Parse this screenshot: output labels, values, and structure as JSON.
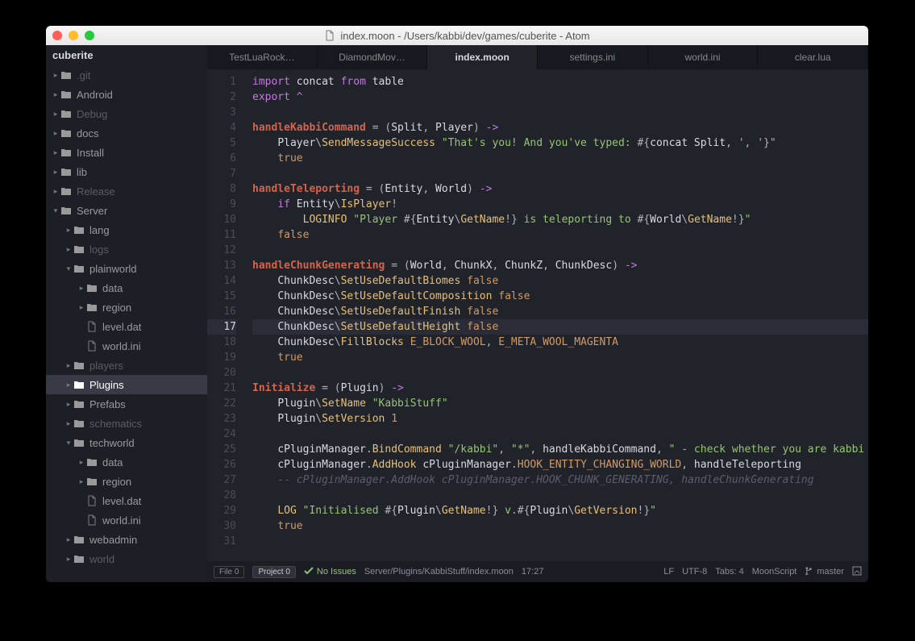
{
  "window": {
    "title": "index.moon - /Users/kabbi/dev/games/cuberite - Atom"
  },
  "sidebar": {
    "project": "cuberite",
    "tree": [
      {
        "label": ".git",
        "type": "folder",
        "depth": 0,
        "open": false,
        "dim": true
      },
      {
        "label": "Android",
        "type": "folder",
        "depth": 0,
        "open": false
      },
      {
        "label": "Debug",
        "type": "folder",
        "depth": 0,
        "open": false,
        "dim": true
      },
      {
        "label": "docs",
        "type": "folder",
        "depth": 0,
        "open": false
      },
      {
        "label": "Install",
        "type": "folder",
        "depth": 0,
        "open": false
      },
      {
        "label": "lib",
        "type": "folder",
        "depth": 0,
        "open": false
      },
      {
        "label": "Release",
        "type": "folder",
        "depth": 0,
        "open": false,
        "dim": true
      },
      {
        "label": "Server",
        "type": "folder",
        "depth": 0,
        "open": true
      },
      {
        "label": "lang",
        "type": "folder",
        "depth": 1,
        "open": false
      },
      {
        "label": "logs",
        "type": "folder",
        "depth": 1,
        "open": false,
        "dim": true
      },
      {
        "label": "plainworld",
        "type": "folder",
        "depth": 1,
        "open": true
      },
      {
        "label": "data",
        "type": "folder",
        "depth": 2,
        "open": false
      },
      {
        "label": "region",
        "type": "folder",
        "depth": 2,
        "open": false
      },
      {
        "label": "level.dat",
        "type": "file",
        "depth": 2
      },
      {
        "label": "world.ini",
        "type": "file",
        "depth": 2
      },
      {
        "label": "players",
        "type": "folder",
        "depth": 1,
        "open": false,
        "dim": true
      },
      {
        "label": "Plugins",
        "type": "folder",
        "depth": 1,
        "open": false,
        "selected": true
      },
      {
        "label": "Prefabs",
        "type": "folder",
        "depth": 1,
        "open": false
      },
      {
        "label": "schematics",
        "type": "folder",
        "depth": 1,
        "open": false,
        "dim": true
      },
      {
        "label": "techworld",
        "type": "folder",
        "depth": 1,
        "open": true
      },
      {
        "label": "data",
        "type": "folder",
        "depth": 2,
        "open": false
      },
      {
        "label": "region",
        "type": "folder",
        "depth": 2,
        "open": false
      },
      {
        "label": "level.dat",
        "type": "file",
        "depth": 2
      },
      {
        "label": "world.ini",
        "type": "file",
        "depth": 2
      },
      {
        "label": "webadmin",
        "type": "folder",
        "depth": 1,
        "open": false
      },
      {
        "label": "world",
        "type": "folder",
        "depth": 1,
        "open": false,
        "dim": true
      }
    ]
  },
  "tabs": [
    {
      "label": "TestLuaRock…"
    },
    {
      "label": "DiamondMov…"
    },
    {
      "label": "index.moon",
      "active": true
    },
    {
      "label": "settings.ini"
    },
    {
      "label": "world.ini"
    },
    {
      "label": "clear.lua"
    }
  ],
  "editor": {
    "active_line": 17,
    "lines": [
      [
        [
          "kw",
          "import"
        ],
        [
          "p",
          " "
        ],
        [
          "id",
          "concat"
        ],
        [
          "p",
          " "
        ],
        [
          "kw",
          "from"
        ],
        [
          "p",
          " "
        ],
        [
          "id",
          "table"
        ]
      ],
      [
        [
          "kw",
          "export"
        ],
        [
          "p",
          " "
        ],
        [
          "op",
          "^"
        ]
      ],
      [],
      [
        [
          "def",
          "handleKabbiCommand"
        ],
        [
          "p",
          " = ("
        ],
        [
          "id",
          "Split"
        ],
        [
          "p",
          ", "
        ],
        [
          "id",
          "Player"
        ],
        [
          "p",
          ") "
        ],
        [
          "op",
          "->"
        ]
      ],
      [
        [
          "p",
          "    "
        ],
        [
          "id",
          "Player"
        ],
        [
          "p",
          "\\"
        ],
        [
          "meth",
          "SendMessageSuccess"
        ],
        [
          "p",
          " "
        ],
        [
          "str",
          "\"That's you! And you've typed: "
        ],
        [
          "p",
          "#{"
        ],
        [
          "id",
          "concat"
        ],
        [
          "p",
          " "
        ],
        [
          "id",
          "Split"
        ],
        [
          "p",
          ", "
        ],
        [
          "str",
          "', '"
        ],
        [
          "p",
          "}"
        ],
        [
          "str",
          "\""
        ]
      ],
      [
        [
          "p",
          "    "
        ],
        [
          "true",
          "true"
        ]
      ],
      [],
      [
        [
          "def",
          "handleTeleporting"
        ],
        [
          "p",
          " = ("
        ],
        [
          "id",
          "Entity"
        ],
        [
          "p",
          ", "
        ],
        [
          "id",
          "World"
        ],
        [
          "p",
          ") "
        ],
        [
          "op",
          "->"
        ]
      ],
      [
        [
          "p",
          "    "
        ],
        [
          "kw",
          "if"
        ],
        [
          "p",
          " "
        ],
        [
          "id",
          "Entity"
        ],
        [
          "p",
          "\\"
        ],
        [
          "meth",
          "IsPlayer"
        ],
        [
          "p",
          "!"
        ]
      ],
      [
        [
          "p",
          "        "
        ],
        [
          "meth",
          "LOGINFO"
        ],
        [
          "p",
          " "
        ],
        [
          "str",
          "\"Player "
        ],
        [
          "p",
          "#{"
        ],
        [
          "id",
          "Entity"
        ],
        [
          "p",
          "\\"
        ],
        [
          "meth",
          "GetName"
        ],
        [
          "p",
          "!}"
        ],
        [
          "str",
          " is teleporting to "
        ],
        [
          "p",
          "#{"
        ],
        [
          "id",
          "World"
        ],
        [
          "p",
          "\\"
        ],
        [
          "meth",
          "GetName"
        ],
        [
          "p",
          "!}"
        ],
        [
          "str",
          "\""
        ]
      ],
      [
        [
          "p",
          "    "
        ],
        [
          "false",
          "false"
        ]
      ],
      [],
      [
        [
          "def",
          "handleChunkGenerating"
        ],
        [
          "p",
          " = ("
        ],
        [
          "id",
          "World"
        ],
        [
          "p",
          ", "
        ],
        [
          "id",
          "ChunkX"
        ],
        [
          "p",
          ", "
        ],
        [
          "id",
          "ChunkZ"
        ],
        [
          "p",
          ", "
        ],
        [
          "id",
          "ChunkDesc"
        ],
        [
          "p",
          ") "
        ],
        [
          "op",
          "->"
        ]
      ],
      [
        [
          "p",
          "    "
        ],
        [
          "id",
          "ChunkDesc"
        ],
        [
          "p",
          "\\"
        ],
        [
          "meth",
          "SetUseDefaultBiomes"
        ],
        [
          "p",
          " "
        ],
        [
          "false",
          "false"
        ]
      ],
      [
        [
          "p",
          "    "
        ],
        [
          "id",
          "ChunkDesc"
        ],
        [
          "p",
          "\\"
        ],
        [
          "meth",
          "SetUseDefaultComposition"
        ],
        [
          "p",
          " "
        ],
        [
          "false",
          "false"
        ]
      ],
      [
        [
          "p",
          "    "
        ],
        [
          "id",
          "ChunkDesc"
        ],
        [
          "p",
          "\\"
        ],
        [
          "meth",
          "SetUseDefaultFinish"
        ],
        [
          "p",
          " "
        ],
        [
          "false",
          "false"
        ]
      ],
      [
        [
          "p",
          "    "
        ],
        [
          "id",
          "ChunkDesc"
        ],
        [
          "p",
          "\\"
        ],
        [
          "meth",
          "SetUseDefaultHeight"
        ],
        [
          "p",
          " "
        ],
        [
          "false",
          "false"
        ]
      ],
      [
        [
          "p",
          "    "
        ],
        [
          "id",
          "ChunkDesc"
        ],
        [
          "p",
          "\\"
        ],
        [
          "meth",
          "FillBlocks"
        ],
        [
          "p",
          " "
        ],
        [
          "const",
          "E_BLOCK_WOOL"
        ],
        [
          "p",
          ", "
        ],
        [
          "const",
          "E_META_WOOL_MAGENTA"
        ]
      ],
      [
        [
          "p",
          "    "
        ],
        [
          "true",
          "true"
        ]
      ],
      [],
      [
        [
          "def",
          "Initialize"
        ],
        [
          "p",
          " = ("
        ],
        [
          "id",
          "Plugin"
        ],
        [
          "p",
          ") "
        ],
        [
          "op",
          "->"
        ]
      ],
      [
        [
          "p",
          "    "
        ],
        [
          "id",
          "Plugin"
        ],
        [
          "p",
          "\\"
        ],
        [
          "meth",
          "SetName"
        ],
        [
          "p",
          " "
        ],
        [
          "str",
          "\"KabbiStuff\""
        ]
      ],
      [
        [
          "p",
          "    "
        ],
        [
          "id",
          "Plugin"
        ],
        [
          "p",
          "\\"
        ],
        [
          "meth",
          "SetVersion"
        ],
        [
          "p",
          " "
        ],
        [
          "num",
          "1"
        ]
      ],
      [],
      [
        [
          "p",
          "    "
        ],
        [
          "id",
          "cPluginManager"
        ],
        [
          "p",
          "."
        ],
        [
          "meth",
          "BindCommand"
        ],
        [
          "p",
          " "
        ],
        [
          "str",
          "\"/kabbi\""
        ],
        [
          "p",
          ", "
        ],
        [
          "str",
          "\"*\""
        ],
        [
          "p",
          ", "
        ],
        [
          "id",
          "handleKabbiCommand"
        ],
        [
          "p",
          ", "
        ],
        [
          "str",
          "\" - check whether you are kabbi"
        ]
      ],
      [
        [
          "p",
          "    "
        ],
        [
          "id",
          "cPluginManager"
        ],
        [
          "p",
          "."
        ],
        [
          "meth",
          "AddHook"
        ],
        [
          "p",
          " "
        ],
        [
          "id",
          "cPluginManager"
        ],
        [
          "p",
          "."
        ],
        [
          "const",
          "HOOK_ENTITY_CHANGING_WORLD"
        ],
        [
          "p",
          ", "
        ],
        [
          "id",
          "handleTeleporting"
        ]
      ],
      [
        [
          "p",
          "    "
        ],
        [
          "cm",
          "-- cPluginManager.AddHook cPluginManager.HOOK_CHUNK_GENERATING, handleChunkGenerating"
        ]
      ],
      [],
      [
        [
          "p",
          "    "
        ],
        [
          "meth",
          "LOG"
        ],
        [
          "p",
          " "
        ],
        [
          "str",
          "\"Initialised "
        ],
        [
          "p",
          "#{"
        ],
        [
          "id",
          "Plugin"
        ],
        [
          "p",
          "\\"
        ],
        [
          "meth",
          "GetName"
        ],
        [
          "p",
          "!}"
        ],
        [
          "str",
          " v."
        ],
        [
          "p",
          "#{"
        ],
        [
          "id",
          "Plugin"
        ],
        [
          "p",
          "\\"
        ],
        [
          "meth",
          "GetVersion"
        ],
        [
          "p",
          "!}"
        ],
        [
          "str",
          "\""
        ]
      ],
      [
        [
          "p",
          "    "
        ],
        [
          "true",
          "true"
        ]
      ],
      []
    ]
  },
  "status": {
    "file_box": "File  0",
    "project_box": "Project  0",
    "issues": "No Issues",
    "path": "Server/Plugins/KabbiStuff/index.moon",
    "cursor": "17:27",
    "line_ending": "LF",
    "encoding": "UTF-8",
    "tabs": "Tabs: 4",
    "grammar": "MoonScript",
    "branch": "master"
  }
}
